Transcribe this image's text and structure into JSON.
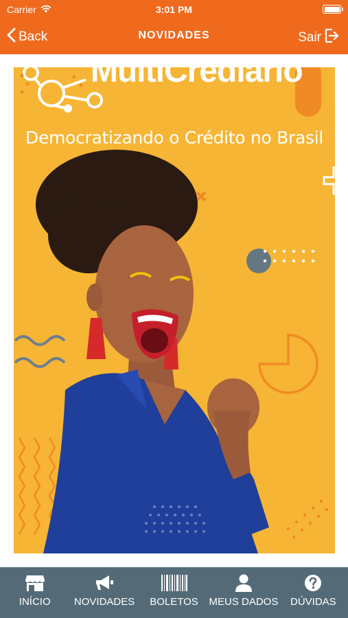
{
  "status_bar": {
    "carrier": "Carrier",
    "time": "3:01 PM"
  },
  "nav": {
    "back_label": "Back",
    "title": "NOVIDADES",
    "logout_label": "Sair"
  },
  "banner": {
    "brand": "MultiCrediario",
    "tagline": "Democratizando o Crédito no Brasil",
    "colors": {
      "background": "#f6b534",
      "accent": "#f08a24"
    }
  },
  "tabbar": {
    "items": [
      {
        "label": "INÍCIO",
        "icon": "store-icon"
      },
      {
        "label": "NOVIDADES",
        "icon": "megaphone-icon"
      },
      {
        "label": "BOLETOS",
        "icon": "barcode-icon"
      },
      {
        "label": "MEUS DADOS",
        "icon": "user-icon"
      },
      {
        "label": "DÚVIDAS",
        "icon": "question-icon"
      }
    ]
  },
  "colors": {
    "header": "#f06a1e",
    "tabbar": "#546b77"
  }
}
